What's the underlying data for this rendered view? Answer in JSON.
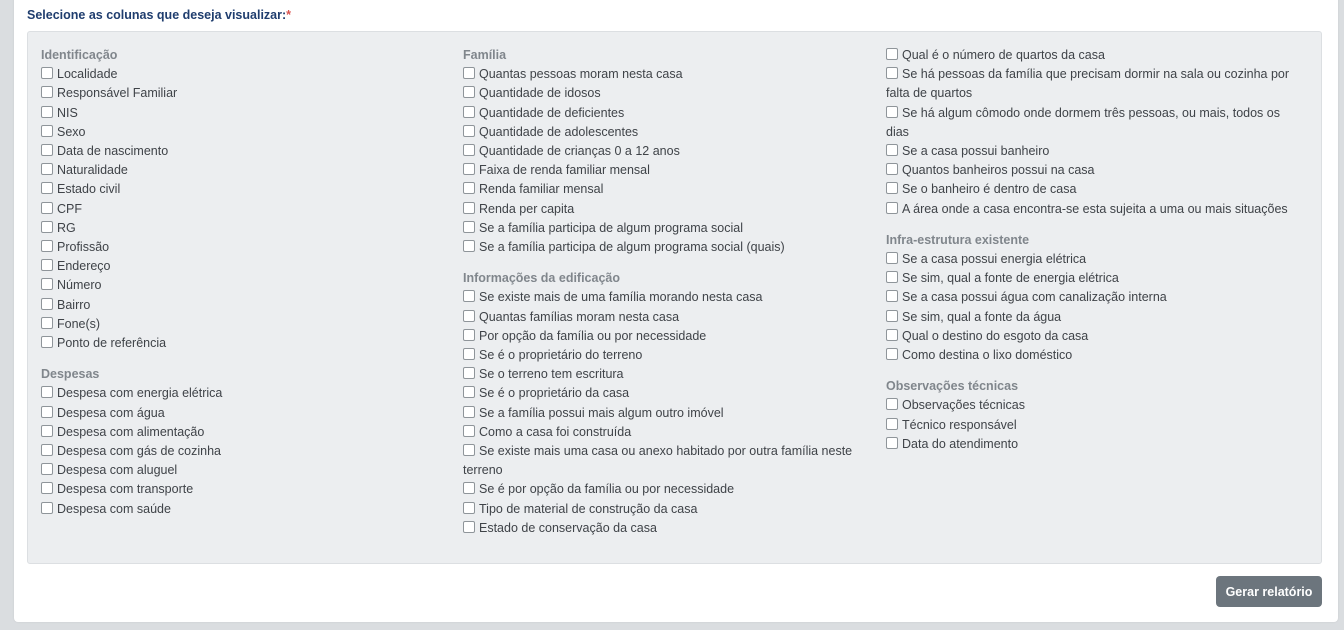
{
  "form": {
    "prompt": "Selecione as colunas que deseja visualizar:",
    "required_mark": "*",
    "submit_label": "Gerar relatório"
  },
  "columns": [
    {
      "sections": [
        {
          "title": "Identificação",
          "options": [
            "Localidade",
            "Responsável Familiar",
            "NIS",
            "Sexo",
            "Data de nascimento",
            "Naturalidade",
            "Estado civil",
            "CPF",
            "RG",
            "Profissão",
            "Endereço",
            "Número",
            "Bairro",
            "Fone(s)",
            "Ponto de referência"
          ]
        },
        {
          "title": "Despesas",
          "options": [
            "Despesa com energia elétrica",
            "Despesa com água",
            "Despesa com alimentação",
            "Despesa com gás de cozinha",
            "Despesa com aluguel",
            "Despesa com transporte",
            "Despesa com saúde"
          ]
        }
      ]
    },
    {
      "sections": [
        {
          "title": "Família",
          "options": [
            "Quantas pessoas moram nesta casa",
            "Quantidade de idosos",
            "Quantidade de deficientes",
            "Quantidade de adolescentes",
            "Quantidade de crianças 0 a 12 anos",
            "Faixa de renda familiar mensal",
            "Renda familiar mensal",
            "Renda per capita",
            "Se a família participa de algum programa social",
            "Se a família participa de algum programa social (quais)"
          ]
        },
        {
          "title": "Informações da edificação",
          "options": [
            "Se existe mais de uma família morando nesta casa",
            "Quantas famílias moram nesta casa",
            "Por opção da família ou por necessidade",
            "Se é o proprietário do terreno",
            "Se o terreno tem escritura",
            "Se é o proprietário da casa",
            "Se a família possui mais algum outro imóvel",
            "Como a casa foi construída",
            "Se existe mais uma casa ou anexo habitado por outra família neste terreno",
            "Se é por opção da família ou por necessidade",
            "Tipo de material de construção da casa",
            "Estado de conservação da casa"
          ]
        }
      ]
    },
    {
      "sections": [
        {
          "title": "",
          "options": [
            "Qual é o número de quartos da casa",
            "Se há pessoas da família que precisam dormir na sala ou cozinha por falta de quartos",
            "Se há algum cômodo onde dormem três pessoas, ou mais, todos os dias",
            "Se a casa possui banheiro",
            "Quantos banheiros possui na casa",
            "Se o banheiro é dentro de casa",
            "A área onde a casa encontra-se esta sujeita a uma ou mais situações"
          ]
        },
        {
          "title": "Infra-estrutura existente",
          "options": [
            "Se a casa possui energia elétrica",
            "Se sim, qual a fonte de energia elétrica",
            "Se a casa possui água com canalização interna",
            "Se sim, qual a fonte da água",
            "Qual o destino do esgoto da casa",
            "Como destina o lixo doméstico"
          ]
        },
        {
          "title": "Observações técnicas",
          "options": [
            "Observações técnicas",
            "Técnico responsável",
            "Data do atendimento"
          ]
        }
      ]
    }
  ]
}
